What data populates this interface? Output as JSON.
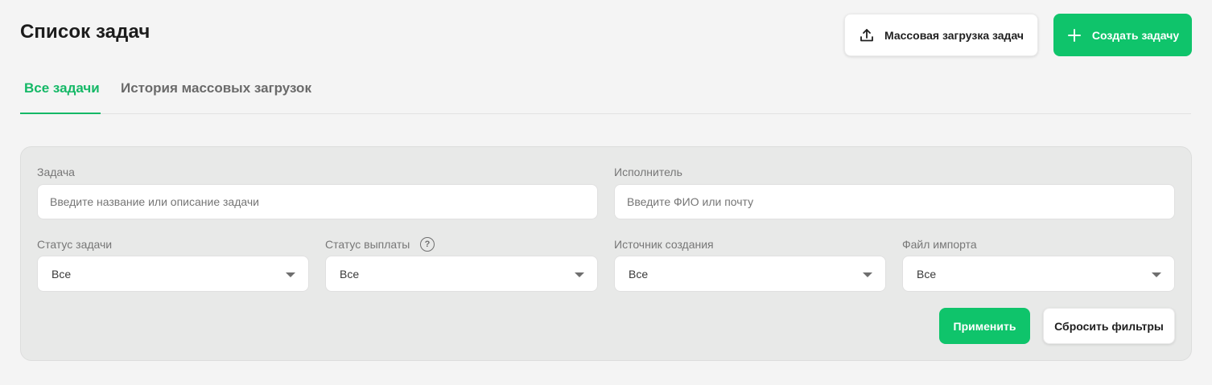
{
  "header": {
    "title": "Список задач",
    "bulk_upload_label": "Массовая загрузка задач",
    "create_label": "Создать задачу"
  },
  "tabs": [
    {
      "label": "Все задачи",
      "active": true
    },
    {
      "label": "История массовых загрузок",
      "active": false
    }
  ],
  "filters": {
    "task": {
      "label": "Задача",
      "placeholder": "Введите название или описание задачи"
    },
    "assignee": {
      "label": "Исполнитель",
      "placeholder": "Введите ФИО или почту"
    },
    "task_status": {
      "label": "Статус задачи",
      "value": "Все"
    },
    "payment_status": {
      "label": "Статус выплаты",
      "value": "Все",
      "help_icon": "?"
    },
    "source": {
      "label": "Источник создания",
      "value": "Все"
    },
    "import_file": {
      "label": "Файл импорта",
      "value": "Все"
    },
    "apply_label": "Применить",
    "reset_label": "Сбросить фильтры"
  },
  "colors": {
    "accent": "#0fc46b",
    "background": "#f4f4f4",
    "panel": "#e8e9e8"
  },
  "icons": [
    "upload-icon",
    "plus-icon",
    "help-circle-icon",
    "chevron-down-icon"
  ]
}
